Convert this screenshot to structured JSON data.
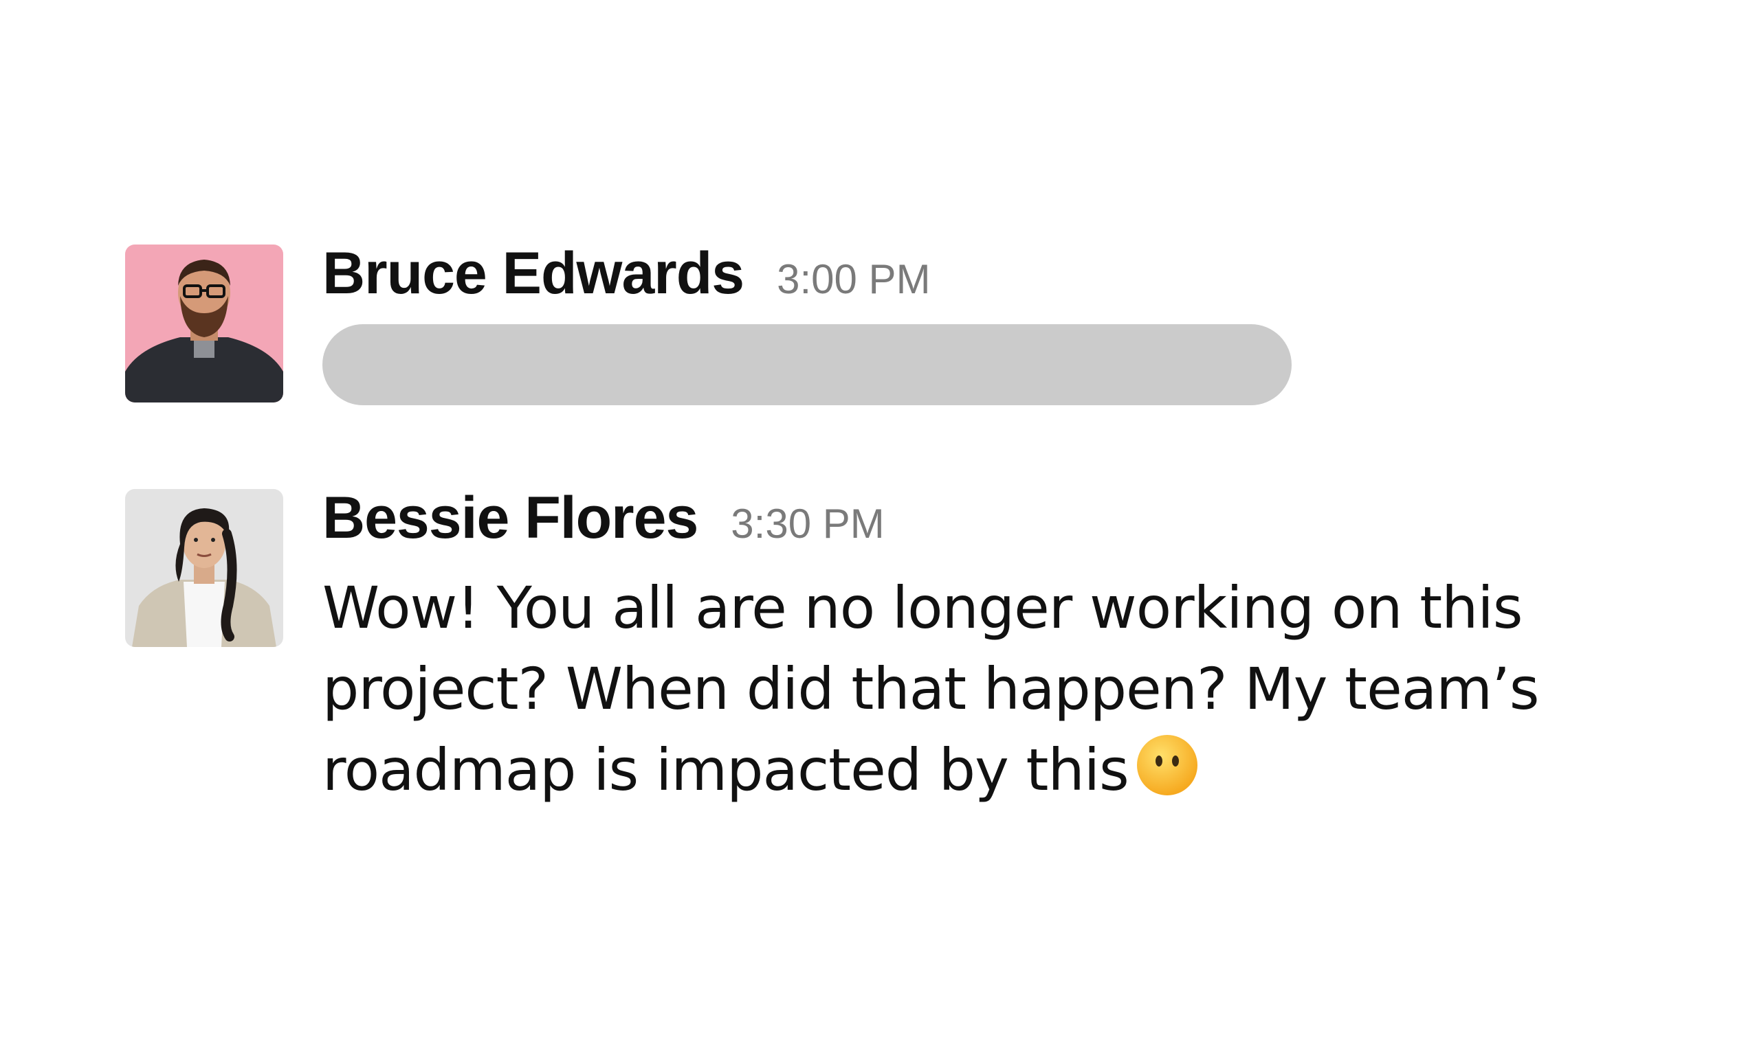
{
  "messages": [
    {
      "sender": "Bruce Edwards",
      "time": "3:00 PM",
      "avatar": "avatar-bruce-edwards",
      "text": "",
      "redacted": true
    },
    {
      "sender": "Bessie Flores",
      "time": "3:30 PM",
      "avatar": "avatar-bessie-flores",
      "text": "Wow! You all are no longer working on this project? When did that happen? My team’s roadmap is impacted by this",
      "emoji": "face-without-mouth-icon"
    }
  ],
  "colors": {
    "placeholder_bar": "#cbcbcb",
    "timestamp": "#7a7a7a",
    "avatar1_bg": "#f3a6b6",
    "avatar2_bg": "#e3e3e3",
    "emoji": "#ffc83d"
  }
}
